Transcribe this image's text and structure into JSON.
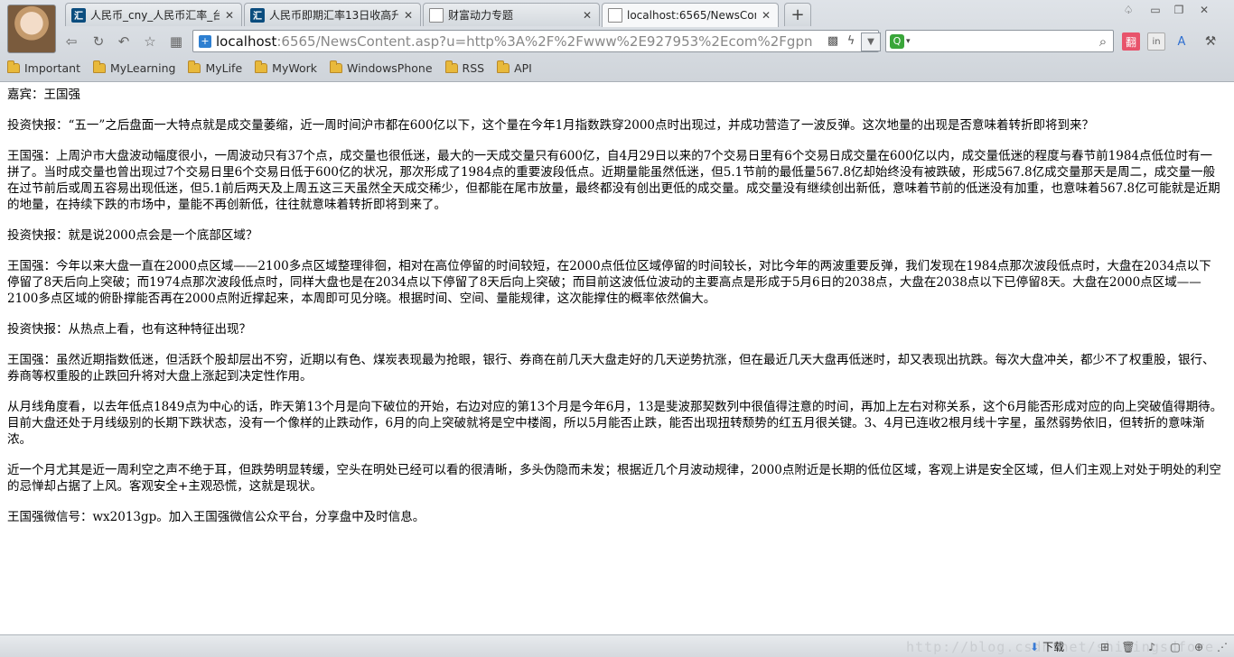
{
  "tabs": [
    {
      "title": "人民币_cny_人民币汇率_台"
    },
    {
      "title": "人民币即期汇率13日收高升"
    },
    {
      "title": "财富动力专题"
    },
    {
      "title": "localhost:6565/NewsCont"
    }
  ],
  "address": {
    "host": "localhost",
    "rest": ":6565/NewsContent.asp?u=http%3A%2F%2Fwww%2E927953%2Ecom%2Fgpn"
  },
  "search": {
    "placeholder": ""
  },
  "bookmarks": [
    "Important",
    "MyLearning",
    "MyLife",
    "MyWork",
    "WindowsPhone",
    "RSS",
    "API"
  ],
  "article": {
    "paragraphs": [
      "嘉宾：王国强",
      "投资快报：“五一”之后盘面一大特点就是成交量萎缩，近一周时间沪市都在600亿以下，这个量在今年1月指数跌穿2000点时出现过，并成功营造了一波反弹。这次地量的出现是否意味着转折即将到来？",
      "王国强：上周沪市大盘波动幅度很小，一周波动只有37个点，成交量也很低迷，最大的一天成交量只有600亿，自4月29日以来的7个交易日里有6个交易日成交量在600亿以内，成交量低迷的程度与春节前1984点低位时有一拼了。当时成交量也曾出现过7个交易日里6个交易日低于600亿的状况，那次形成了1984点的重要波段低点。近期量能虽然低迷，但5.1节前的最低量567.8亿却始终没有被跌破，形成567.8亿成交量那天是周二，成交量一般在过节前后或周五容易出现低迷，但5.1前后两天及上周五这三天虽然全天成交稀少，但都能在尾市放量，最终都没有创出更低的成交量。成交量没有继续创出新低，意味着节前的低迷没有加重，也意味着567.8亿可能就是近期的地量，在持续下跌的市场中，量能不再创新低，往往就意味着转折即将到来了。",
      "投资快报：就是说2000点会是一个底部区域？",
      "王国强：今年以来大盘一直在2000点区域——2100多点区域整理徘徊，相对在高位停留的时间较短，在2000点低位区域停留的时间较长，对比今年的两波重要反弹，我们发现在1984点那次波段低点时，大盘在2034点以下停留了8天后向上突破；而1974点那次波段低点时，同样大盘也是在2034点以下停留了8天后向上突破；而目前这波低位波动的主要高点是形成于5月6日的2038点，大盘在2038点以下已停留8天。大盘在2000点区域——2100多点区域的俯卧撑能否再在2000点附近撑起来，本周即可见分晓。根据时间、空间、量能规律，这次能撑住的概率依然偏大。",
      "投资快报：从热点上看，也有这种特征出现？",
      "王国强：虽然近期指数低迷，但活跃个股却层出不穷，近期以有色、煤炭表现最为抢眼，银行、券商在前几天大盘走好的几天逆势抗涨，但在最近几天大盘再低迷时，却又表现出抗跌。每次大盘冲关，都少不了权重股，银行、券商等权重股的止跌回升将对大盘上涨起到决定性作用。",
      "从月线角度看，以去年低点1849点为中心的话，昨天第13个月是向下破位的开始，右边对应的第13个月是今年6月，13是斐波那契数列中很值得注意的时间，再加上左右对称关系，这个6月能否形成对应的向上突破值得期待。目前大盘还处于月线级别的长期下跌状态，没有一个像样的止跌动作，6月的向上突破就将是空中楼阁，所以5月能否止跌，能否出现扭转颓势的红五月很关键。3、4月已连收2根月线十字星，虽然弱势依旧，但转折的意味渐浓。",
      "近一个月尤其是近一周利空之声不绝于耳，但跌势明显转缓，空头在明处已经可以看的很清晰，多头伪隐而未发；根据近几个月波动规律，2000点附近是长期的低位区域，客观上讲是安全区域，但人们主观上对处于明处的利空的忌惮却占据了上风。客观安全+主观恐慌，这就是现状。",
      "王国强微信号：wx2013gp。加入王国强微信公众平台，分享盘中及时信息。"
    ]
  },
  "statusbar": {
    "watermark": "http://blog.csdn.net/shiningsdfore",
    "download_label": "下载"
  }
}
